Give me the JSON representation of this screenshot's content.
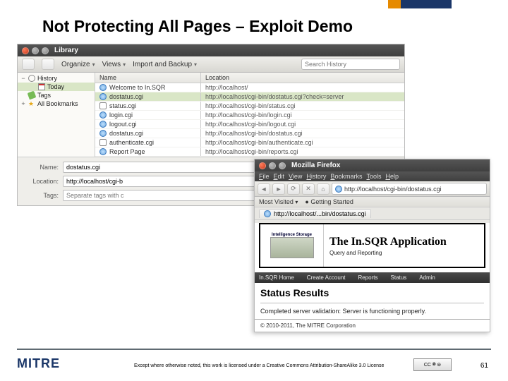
{
  "slide": {
    "title": "Not Protecting All Pages – Exploit Demo",
    "page_number": "61",
    "license_text": "Except where otherwise noted, this work is licensed under a Creative Commons Attribution-ShareAlike 3.0 License",
    "mitre": "MITRE"
  },
  "library": {
    "window_title": "Library",
    "toolbar": {
      "organize": "Organize",
      "views": "Views",
      "import": "Import and Backup",
      "search_placeholder": "Search History"
    },
    "tree": [
      {
        "label": "History",
        "icon": "clock",
        "expanded": true,
        "depth": 0
      },
      {
        "label": "Today",
        "icon": "cal",
        "selected": true,
        "depth": 1
      },
      {
        "label": "Tags",
        "icon": "tag",
        "depth": 0
      },
      {
        "label": "All Bookmarks",
        "icon": "star",
        "expanded": false,
        "depth": 0
      }
    ],
    "columns": {
      "name": "Name",
      "location": "Location"
    },
    "rows": [
      {
        "name": "Welcome to In.SQR",
        "location": "http://localhost/",
        "icon": "globe"
      },
      {
        "name": "dostatus.cgi",
        "location": "http://localhost/cgi-bin/dostatus.cgi?check=server",
        "icon": "globe",
        "selected": true
      },
      {
        "name": "status.cgi",
        "location": "http://localhost/cgi-bin/status.cgi",
        "icon": "doc"
      },
      {
        "name": "login.cgi",
        "location": "http://localhost/cgi-bin/login.cgi",
        "icon": "globe"
      },
      {
        "name": "logout.cgi",
        "location": "http://localhost/cgi-bin/logout.cgi",
        "icon": "globe"
      },
      {
        "name": "dostatus.cgi",
        "location": "http://localhost/cgi-bin/dostatus.cgi",
        "icon": "globe"
      },
      {
        "name": "authenticate.cgi",
        "location": "http://localhost/cgi-bin/authenticate.cgi",
        "icon": "doc"
      },
      {
        "name": "Report Page",
        "location": "http://localhost/cgi-bin/reports.cgi",
        "icon": "globe"
      }
    ],
    "details": {
      "name_label": "Name:",
      "name_value": "dostatus.cgi",
      "location_label": "Location:",
      "location_value": "http://localhost/cgi-b",
      "tags_label": "Tags:",
      "tags_placeholder": "Separate tags with c"
    }
  },
  "firefox": {
    "window_title": "Mozilla Firefox",
    "menus": [
      "File",
      "Edit",
      "View",
      "History",
      "Bookmarks",
      "Tools",
      "Help"
    ],
    "url_display": "http://localhost/cgi-bin/dostatus.cgi",
    "bookmarks_bar": {
      "most_visited": "Most Visited",
      "getting_started": "Getting Started"
    },
    "tab_title": "http://localhost/...bin/dostatus.cgi",
    "page": {
      "banner_top": "Intelligence Storage",
      "app_title": "The In.SQR Application",
      "app_sub": "Query and Reporting",
      "nav": [
        "In.SQR Home",
        "Create Account",
        "Reports",
        "Status",
        "Admin"
      ],
      "heading": "Status Results",
      "body": "Completed server validation: Server is functioning properly.",
      "footer": "© 2010-2011, The MITRE Corporation"
    }
  }
}
